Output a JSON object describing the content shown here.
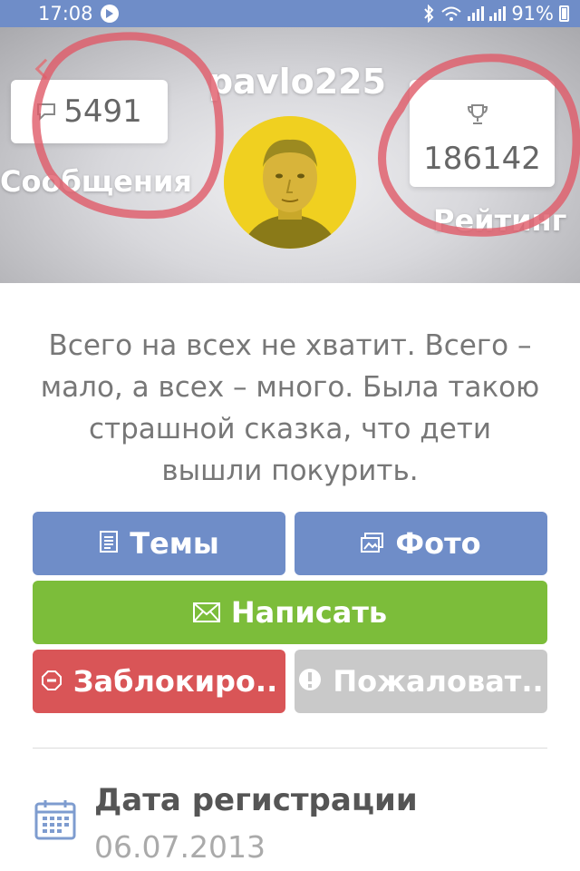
{
  "status_bar": {
    "time": "17:08",
    "battery": "91%",
    "icons": [
      "notification-icon",
      "bluetooth-icon",
      "wifi-icon",
      "signal-icon",
      "signal-icon",
      "battery-icon"
    ]
  },
  "profile": {
    "username": "pavlo225",
    "messages_count": "5491",
    "messages_label": "Сообщения",
    "rating_value": "186142",
    "rating_label": "Рейтинг",
    "status": "Всего на всех не хватит. Всего – мало, а всех – много.  Была такою страшной сказка, что дети вышли покурить."
  },
  "actions": {
    "topics": "Темы",
    "photo": "Фото",
    "write": "Написать",
    "block": "Заблокиро..",
    "report": "Пожаловат.."
  },
  "details": {
    "reg_label": "Дата регистрации",
    "reg_date": "06.07.2013"
  },
  "colors": {
    "accent_blue": "#6f8dc8",
    "green": "#7cbd3a",
    "red": "#d95557",
    "disabled_gray": "#c9c9c9",
    "annotation_red": "#e05a68"
  }
}
